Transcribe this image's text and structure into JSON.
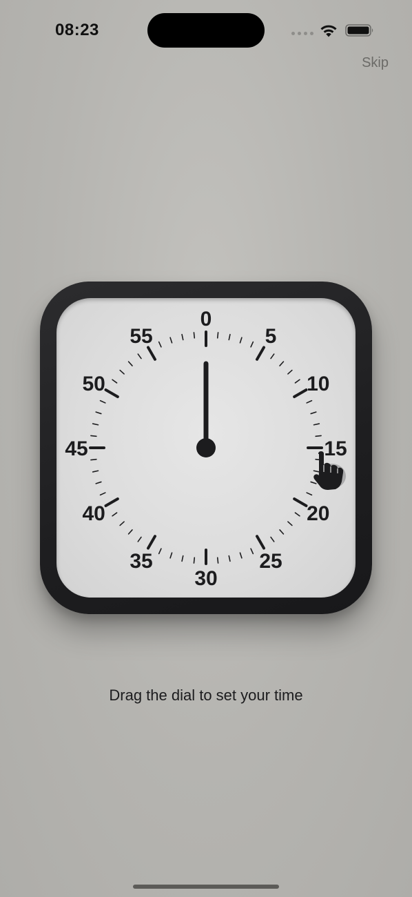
{
  "status_bar": {
    "time": "08:23",
    "wifi_icon": "wifi-icon",
    "battery_icon": "battery-icon",
    "signal_icon": "cellular-signal-icon"
  },
  "header": {
    "skip_label": "Skip"
  },
  "timer": {
    "dial_labels": [
      "0",
      "5",
      "10",
      "15",
      "20",
      "25",
      "30",
      "35",
      "40",
      "45",
      "50",
      "55"
    ],
    "set_minutes": 0,
    "hand_color": "#1c1c1e",
    "frame_color": "#2c2c2e",
    "face_color": "#dcdcdc",
    "drag_hint_icon": "hand-pointer-icon"
  },
  "instruction": "Drag the dial to set your time"
}
